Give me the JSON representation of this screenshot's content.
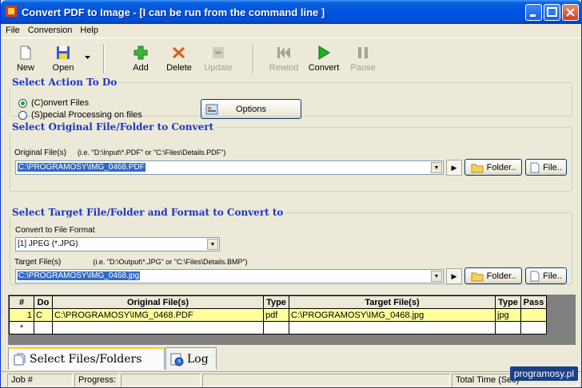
{
  "window": {
    "title": "Convert PDF to Image - [I can be run from the command line ]"
  },
  "menu": [
    "File",
    "Conversion",
    "Help"
  ],
  "toolbar": {
    "new": "New",
    "open": "Open",
    "add": "Add",
    "delete": "Delete",
    "update": "Update",
    "rewind": "Rewind",
    "convert": "Convert",
    "pause": "Pause"
  },
  "action": {
    "legend": "Select Action To Do",
    "convert_files": "(C)onvert Files",
    "special": "(S)pecial Processing on files",
    "options": "Options"
  },
  "original": {
    "legend": "Select Original File/Folder to Convert",
    "label": "Original File(s)",
    "hint": "(i.e. \"D:\\Input\\*.PDF\"  or \"C:\\Files\\Details.PDF\")",
    "value": "C:\\PROGRAMOSY\\IMG_0468.PDF",
    "folder": "Folder..",
    "file": "File.."
  },
  "target": {
    "legend": "Select Target File/Folder and Format to Convert to",
    "format_label": "Convert to File Format",
    "format_value": "[1] JPEG (*.JPG)",
    "label": "Target File(s)",
    "hint": "(i.e. \"D:\\Output\\*.JPG\"  or \"C:\\Files\\Details.BMP\")",
    "value": "C:\\PROGRAMOSY\\IMG_0468.jpg",
    "folder": "Folder..",
    "file": "File.."
  },
  "grid": {
    "headers": [
      "#",
      "Do",
      "Original File(s)",
      "Type",
      "Target File(s)",
      "Type",
      "Pass"
    ],
    "rows": [
      [
        "1",
        "C",
        "C:\\PROGRAMOSY\\IMG_0468.PDF",
        "pdf",
        "C:\\PROGRAMOSY\\IMG_0468.jpg",
        "jpg",
        ""
      ],
      [
        "*",
        "",
        "",
        "",
        "",
        "",
        ""
      ]
    ]
  },
  "tabs": {
    "files": "Select Files/Folders",
    "log": "Log"
  },
  "status": {
    "job": "Job #",
    "progress": "Progress:",
    "total": "Total Time (Sec)"
  },
  "watermark": "programosy.pl"
}
